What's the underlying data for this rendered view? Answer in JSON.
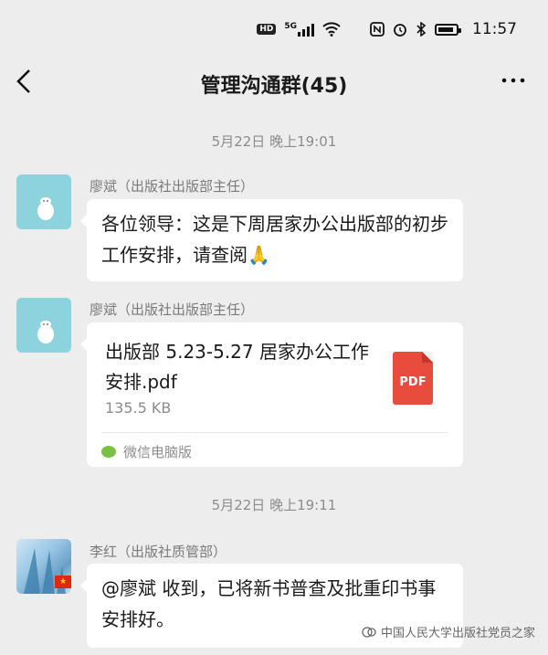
{
  "status_bar": {
    "hd": "HD",
    "network": "5G",
    "time": "11:57"
  },
  "header": {
    "title": "管理沟通群(45)",
    "back": "‹",
    "more": "•••"
  },
  "messages": {
    "ts1": "5月22日 晚上19:01",
    "m1_sender": "廖斌（出版社出版部主任）",
    "m1_text": "各位领导：这是下周居家办公出版部的初步工作安排，请查阅🙏",
    "m2_sender": "廖斌（出版社出版部主任）",
    "file_name": "出版部 5.23-5.27 居家办公工作安排.pdf",
    "file_size": "135.5 KB",
    "file_icon_label": "PDF",
    "file_source": "微信电脑版",
    "ts2": "5月22日 晚上19:11",
    "m3_sender": "李红（出版社质管部）",
    "m3_text": "@廖斌  收到，已将新书普查及批重印书事安排好。"
  },
  "watermark": "中国人民大学出版社党员之家",
  "colors": {
    "pdf": "#e74c3c",
    "background": "#ededed"
  }
}
